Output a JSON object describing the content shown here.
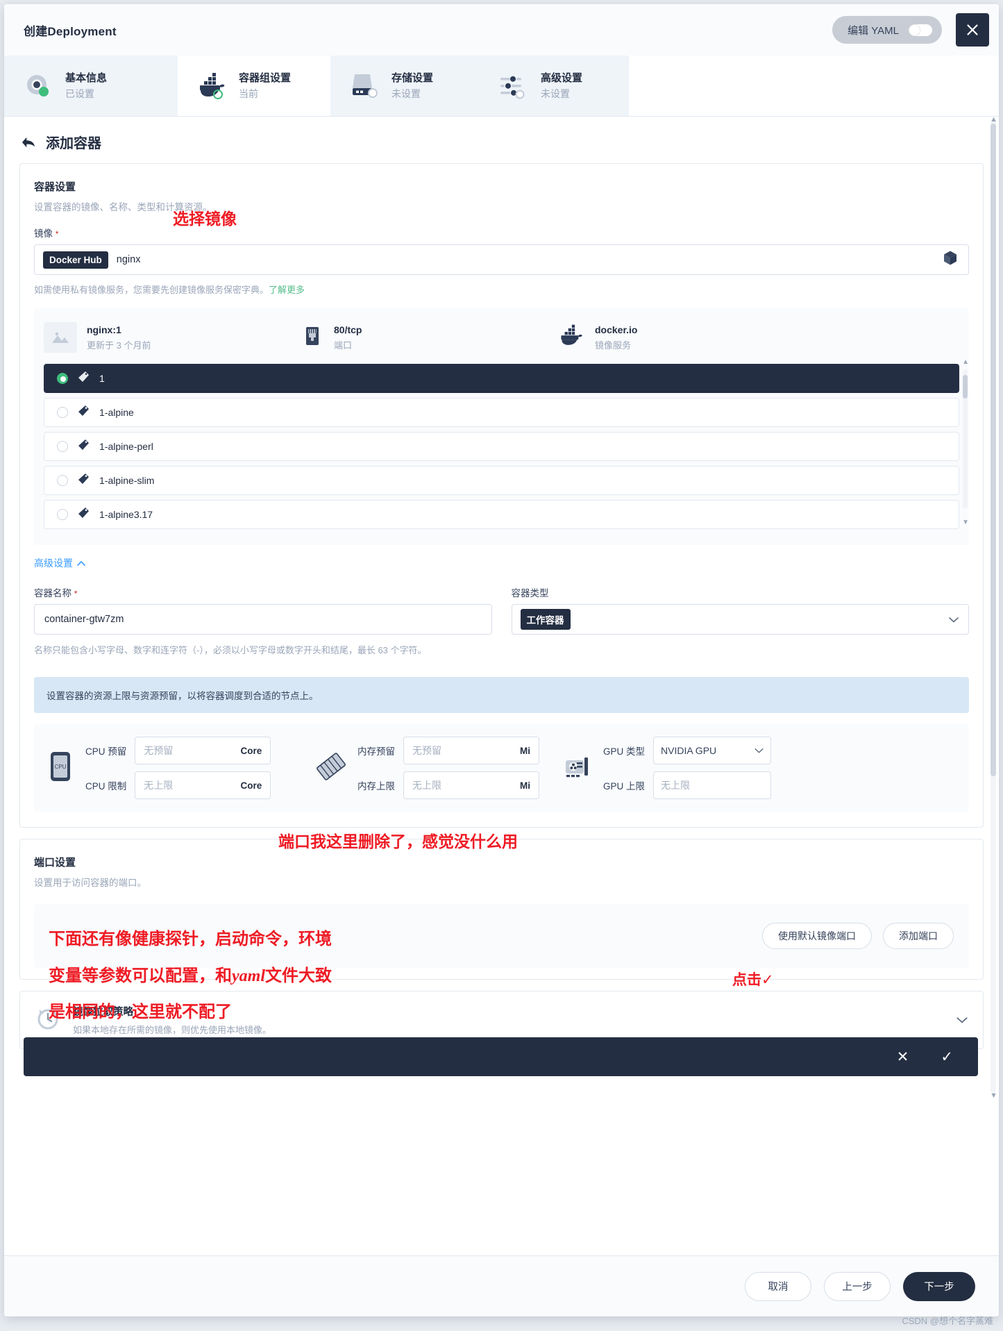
{
  "header": {
    "title": "创建Deployment",
    "yaml_toggle_label": "编辑 YAML",
    "close_label": "X"
  },
  "steps": [
    {
      "label": "基本信息",
      "status": "已设置",
      "icon": "target-icon"
    },
    {
      "label": "容器组设置",
      "status": "当前",
      "icon": "docker-whale-icon"
    },
    {
      "label": "存储设置",
      "status": "未设置",
      "icon": "storage-icon"
    },
    {
      "label": "高级设置",
      "status": "未设置",
      "icon": "sliders-icon"
    }
  ],
  "page": {
    "title": "添加容器",
    "back_icon": "back-arrow-icon"
  },
  "container_settings": {
    "section_title": "容器设置",
    "section_desc": "设置容器的镜像、名称、类型和计算资源。",
    "image_label": "镜像",
    "required_mark": "*",
    "registry_chip": "Docker Hub",
    "image_value": "nginx",
    "image_box_icon": "cube-icon",
    "helper_text": "如需使用私有镜像服务，您需要先创建镜像服务保密字典。",
    "helper_link": "了解更多",
    "image_meta": [
      {
        "icon": "image-thumb-icon",
        "title": "nginx:1",
        "sub": "更新于 3 个月前"
      },
      {
        "icon": "port-icon",
        "title": "80/tcp",
        "sub": "端口"
      },
      {
        "icon": "docker-whale-icon",
        "title": "docker.io",
        "sub": "镜像服务"
      }
    ],
    "tags": [
      {
        "name": "1",
        "selected": true
      },
      {
        "name": "1-alpine",
        "selected": false
      },
      {
        "name": "1-alpine-perl",
        "selected": false
      },
      {
        "name": "1-alpine-slim",
        "selected": false
      },
      {
        "name": "1-alpine3.17",
        "selected": false
      }
    ],
    "advanced_toggle": "高级设置",
    "advanced_chevron": "chevron-up-icon",
    "name_label": "容器名称",
    "name_value": "container-gtw7zm",
    "name_note": "名称只能包含小写字母、数字和连字符（-），必须以小写字母或数字开头和结尾，最长 63 个字符。",
    "type_label": "容器类型",
    "type_value": "工作容器",
    "type_chevron": "chevron-down-icon",
    "resource_banner": "设置容器的资源上限与资源预留，以将容器调度到合适的节点上。",
    "resources": {
      "cpu_icon": "cpu-icon",
      "cpu_reserve_label": "CPU 预留",
      "cpu_reserve_placeholder": "无预留",
      "cpu_reserve_unit": "Core",
      "cpu_limit_label": "CPU 限制",
      "cpu_limit_placeholder": "无上限",
      "cpu_limit_unit": "Core",
      "mem_icon": "memory-icon",
      "mem_reserve_label": "内存预留",
      "mem_reserve_placeholder": "无预留",
      "mem_reserve_unit": "Mi",
      "mem_limit_label": "内存上限",
      "mem_limit_placeholder": "无上限",
      "mem_limit_unit": "Mi",
      "gpu_icon": "gpu-icon",
      "gpu_type_label": "GPU 类型",
      "gpu_type_value": "NVIDIA GPU",
      "gpu_limit_label": "GPU 上限",
      "gpu_limit_placeholder": "无上限"
    }
  },
  "ports": {
    "section_title": "端口设置",
    "section_desc": "设置用于访问容器的端口。",
    "default_port_button": "使用默认镜像端口",
    "add_port_button": "添加端口"
  },
  "pull_policy": {
    "icon": "clock-arrow-icon",
    "title": "镜像拉取策略",
    "desc": "如果本地存在所需的镜像，则优先使用本地镜像。",
    "chevron": "chevron-down-icon"
  },
  "dark_bar": {
    "cancel_icon": "close-icon",
    "confirm_icon": "check-icon"
  },
  "footer": {
    "cancel": "取消",
    "prev": "上一步",
    "next": "下一步"
  },
  "annotations": [
    {
      "id": "anno-select-image",
      "text": "选择镜像"
    },
    {
      "id": "anno-ports",
      "text": "端口我这里删除了，感觉没什么用"
    },
    {
      "id": "anno-more-1",
      "text": "下面还有像健康探针，启动命令，环境"
    },
    {
      "id": "anno-more-2-a",
      "text": "变量等参数可以配置，和"
    },
    {
      "id": "anno-more-2-b",
      "text": "yaml"
    },
    {
      "id": "anno-more-2-c",
      "text": "文件大致"
    },
    {
      "id": "anno-more-3",
      "text": "是相同的，这里就不配了"
    },
    {
      "id": "anno-click",
      "text": "点击✓"
    }
  ],
  "watermark": "CSDN @想个名字蒸难"
}
